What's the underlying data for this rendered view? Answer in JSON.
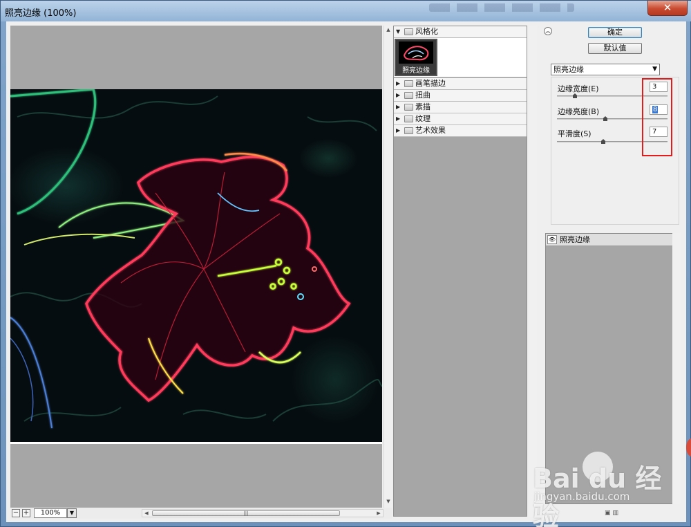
{
  "window": {
    "title": "照亮边缘 (100%)",
    "close_glyph": "✕"
  },
  "preview": {
    "zoom_value": "100%",
    "zoom_out_glyph": "−",
    "zoom_in_glyph": "+",
    "zoom_drop_glyph": "▼",
    "scroll_left_glyph": "◀",
    "scroll_right_glyph": "▶",
    "scroll_up_glyph": "▲",
    "scroll_down_glyph": "▼",
    "scroll_grip": "|||"
  },
  "gallery": {
    "expanded_category": "风格化",
    "selected_thumbnail_label": "照亮边缘",
    "categories": [
      "画笔描边",
      "扭曲",
      "素描",
      "纹理",
      "艺术效果"
    ]
  },
  "settings": {
    "collapse_glyph": "︽",
    "ok_label": "确定",
    "default_label": "默认值",
    "selected_filter": "照亮边缘",
    "select_arrow": "▼",
    "params": [
      {
        "label": "边缘宽度(E)",
        "value": "3",
        "slider_fraction": 0.16
      },
      {
        "label": "边缘亮度(B)",
        "value": "8",
        "slider_fraction": 0.44
      },
      {
        "label": "平滑度(S)",
        "value": "7",
        "slider_fraction": 0.42
      }
    ]
  },
  "layers": {
    "items": [
      {
        "label": "照亮边缘",
        "visible_glyph": "👁"
      }
    ],
    "icons_text": "▣ ▥"
  },
  "watermark": {
    "text": "Bai du 经验",
    "url": "jingyan.baidu.com"
  },
  "colors": {
    "highlight_box": "#e21c1c",
    "canvas_gray": "#a6a6a6",
    "image_bg": "#060d10"
  }
}
